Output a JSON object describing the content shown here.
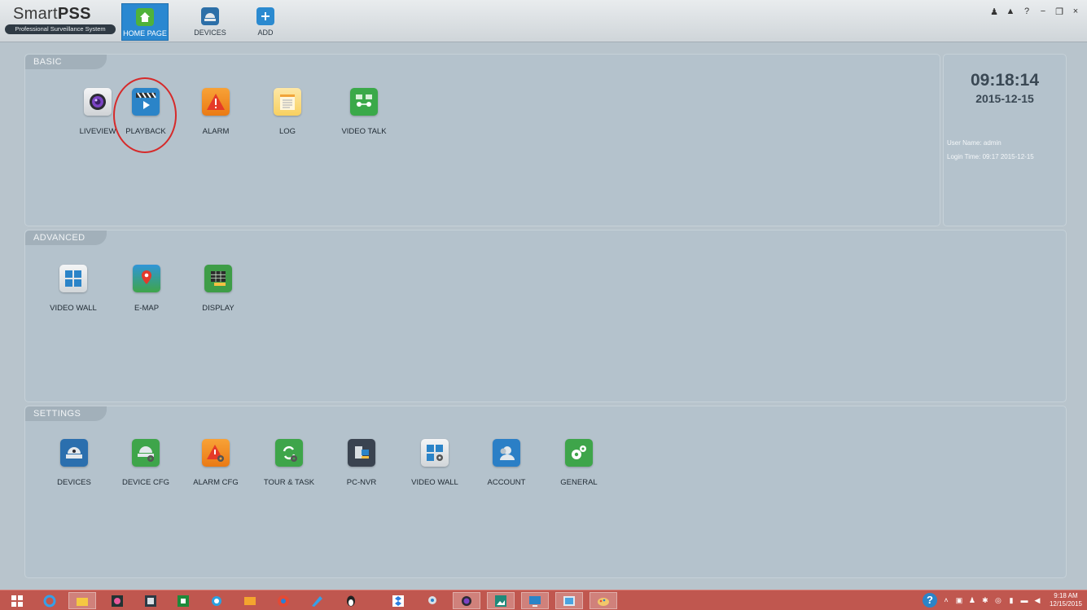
{
  "app": {
    "name_light": "Smart",
    "name_bold": "PSS",
    "subtitle": "Professional Surveillance System"
  },
  "nav": [
    {
      "label": "HOME PAGE",
      "icon": "home-icon",
      "active": true
    },
    {
      "label": "DEVICES",
      "icon": "camera-dome-icon",
      "active": false
    },
    {
      "label": "ADD",
      "icon": "plus-icon",
      "active": false
    }
  ],
  "window_controls": [
    "person-icon",
    "lock-icon",
    "?",
    "−",
    "restore-icon",
    "×"
  ],
  "basic": {
    "title": "BASIC",
    "items": [
      {
        "label": "LIVEVIEW",
        "icon": "liveview-camera-icon"
      },
      {
        "label": "PLAYBACK",
        "icon": "playback-clapper-icon"
      },
      {
        "label": "ALARM",
        "icon": "alarm-warning-icon"
      },
      {
        "label": "LOG",
        "icon": "log-list-icon"
      },
      {
        "label": "VIDEO TALK",
        "icon": "video-talk-icon"
      }
    ]
  },
  "advanced": {
    "title": "ADVANCED",
    "items": [
      {
        "label": "VIDEO WALL",
        "icon": "video-wall-icon"
      },
      {
        "label": "E-MAP",
        "icon": "map-pin-icon"
      },
      {
        "label": "DISPLAY",
        "icon": "display-grid-icon"
      }
    ]
  },
  "settings": {
    "title": "SETTINGS",
    "items": [
      {
        "label": "DEVICES",
        "icon": "dome-camera-icon"
      },
      {
        "label": "DEVICE CFG",
        "icon": "device-cfg-icon"
      },
      {
        "label": "ALARM CFG",
        "icon": "alarm-cfg-icon"
      },
      {
        "label": "TOUR & TASK",
        "icon": "tour-task-icon"
      },
      {
        "label": "PC-NVR",
        "icon": "pc-nvr-icon"
      },
      {
        "label": "VIDEO WALL",
        "icon": "video-wall-cfg-icon"
      },
      {
        "label": "ACCOUNT",
        "icon": "account-icon"
      },
      {
        "label": "GENERAL",
        "icon": "gears-icon"
      }
    ]
  },
  "status": {
    "time": "09:18:14",
    "date": "2015-12-15",
    "user_line": "User Name: admin",
    "login_line": "Login Time: 09:17 2015-12-15"
  },
  "taskbar": {
    "clock_time": "9:18 AM",
    "clock_date": "12/15/2015"
  },
  "colors": {
    "accent": "#2a88d1",
    "taskbar": "#c0574f",
    "highlight_circle": "#d62a2a"
  }
}
